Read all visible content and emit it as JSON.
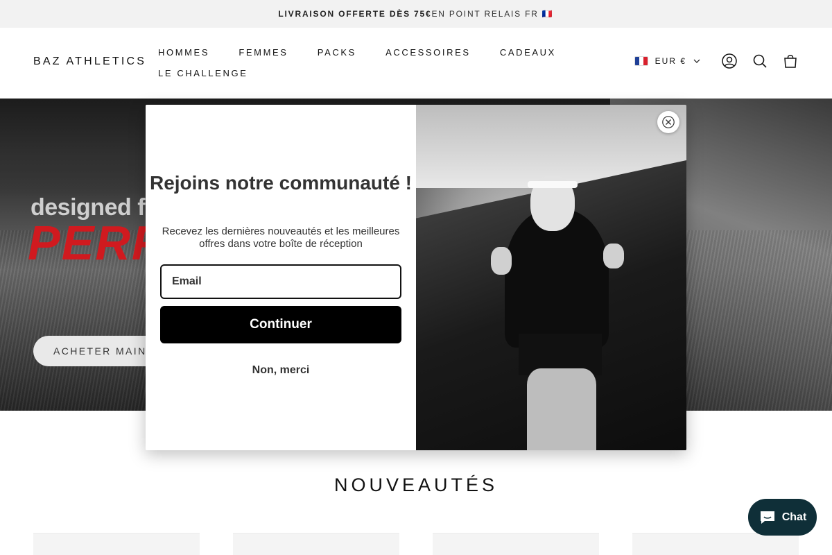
{
  "announcement": {
    "bold": "LIVRAISON OFFERTE DÈS 75€",
    "rest": " EN POINT RELAIS FR 🇫🇷"
  },
  "header": {
    "logo": "BAZ ATHLETICS",
    "nav": [
      "HOMMES",
      "FEMMES",
      "PACKS",
      "ACCESSOIRES",
      "CADEAUX",
      "LE CHALLENGE"
    ],
    "currency": "EUR €"
  },
  "hero": {
    "eyebrow": "designed for",
    "title": "PERFO",
    "cta": "ACHETER MAINTENANT"
  },
  "section": {
    "title": "NOUVEAUTÉS"
  },
  "modal": {
    "heading": "Rejoins notre communauté !",
    "subtitle": "Recevez les dernières nouveautés et les meilleures offres dans votre boîte de réception",
    "email_placeholder": "Email",
    "continue_label": "Continuer",
    "decline_label": "Non, merci"
  },
  "chat": {
    "label": "Chat"
  },
  "icons": {
    "account": "user-icon",
    "search": "search-icon",
    "cart": "bag-icon",
    "close": "close-icon",
    "chat": "chat-bubble-icon",
    "dropdown": "chevron-down-icon"
  },
  "colors": {
    "accent_red": "#d01a1f",
    "chat_bg": "#0f2f38",
    "button_black": "#000000"
  }
}
